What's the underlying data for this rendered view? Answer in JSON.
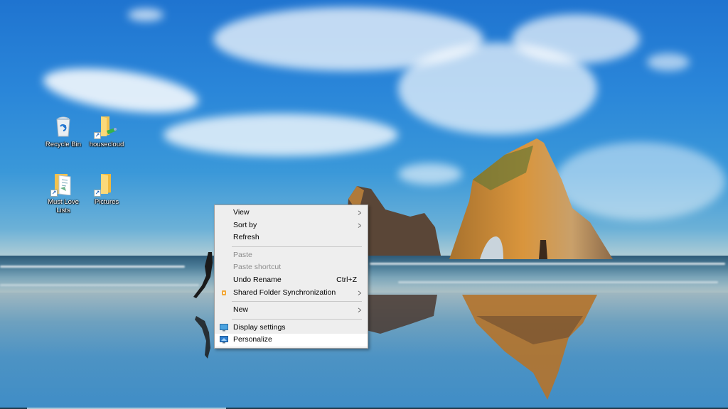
{
  "desktop": {
    "wallpaper": "beach-rock-arch",
    "icons": [
      {
        "label": "Recycle Bin",
        "icon": "recycle-bin-icon",
        "shortcut": false
      },
      {
        "label": "housecloud",
        "icon": "network-folder-icon",
        "shortcut": true
      },
      {
        "label": "Must Love Lists",
        "icon": "document-folder-icon",
        "shortcut": true
      },
      {
        "label": "Pictures",
        "icon": "folder-icon",
        "shortcut": true
      }
    ]
  },
  "context_menu": {
    "items": [
      {
        "label": "View",
        "submenu": true,
        "disabled": false
      },
      {
        "label": "Sort by",
        "submenu": true,
        "disabled": false
      },
      {
        "label": "Refresh",
        "submenu": false,
        "disabled": false
      },
      {
        "label": "Paste",
        "submenu": false,
        "disabled": true
      },
      {
        "label": "Paste shortcut",
        "submenu": false,
        "disabled": true
      },
      {
        "label": "Undo Rename",
        "shortcut": "Ctrl+Z",
        "submenu": false,
        "disabled": false
      },
      {
        "label": "Shared Folder Synchronization",
        "submenu": true,
        "disabled": false,
        "icon": "sync-icon"
      },
      {
        "label": "New",
        "submenu": true,
        "disabled": false
      },
      {
        "label": "Display settings",
        "submenu": false,
        "disabled": false,
        "icon": "display-icon"
      },
      {
        "label": "Personalize",
        "submenu": false,
        "disabled": false,
        "icon": "personalize-icon",
        "highlighted": true
      }
    ],
    "chevron_glyph": ">"
  },
  "colors": {
    "menu_bg": "#eeeeee",
    "menu_highlight": "#ffffff",
    "disabled_text": "#8d8d8d"
  }
}
